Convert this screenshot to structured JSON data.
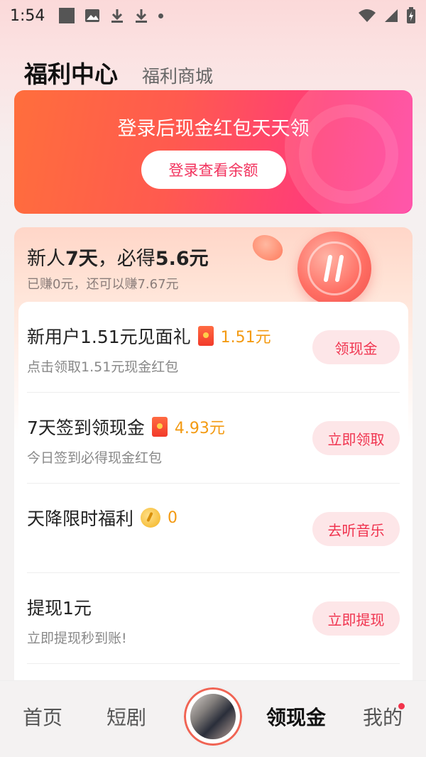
{
  "status": {
    "time": "1:54",
    "left_icons": [
      "square-app-icon",
      "image-icon",
      "download-icon",
      "download-icon",
      "dot-icon"
    ],
    "right_icons": [
      "wifi-icon",
      "signal-icon",
      "battery-icon"
    ]
  },
  "header": {
    "active_tab": "福利中心",
    "inactive_tab": "福利商城"
  },
  "banner": {
    "title": "登录后现金红包天天领",
    "button": "登录查看余额"
  },
  "newbie": {
    "title_prefix": "新人",
    "title_bold1": "7天",
    "title_mid": "，必得",
    "title_bold2": "5.6元",
    "subtitle": "已赚0元，还可以赚7.67元"
  },
  "tasks": [
    {
      "name": "新用户1.51元见面礼",
      "reward": "1.51元",
      "reward_icon": "red-packet-icon",
      "desc": "点击领取1.51元现金红包",
      "button": "领现金"
    },
    {
      "name": "7天签到领现金",
      "reward": "4.93元",
      "reward_icon": "red-packet-icon",
      "desc": "今日签到必得现金红包",
      "button": "立即领取"
    },
    {
      "name": "天降限时福利",
      "reward": "0",
      "reward_icon": "gold-coin-icon",
      "desc": "",
      "button": "去听音乐"
    },
    {
      "name": "提现1元",
      "reward": "",
      "reward_icon": "",
      "desc": "立即提现秒到账!",
      "button": "立即提现"
    }
  ],
  "bottom_nav": {
    "home": "首页",
    "drama": "短剧",
    "cash": "领现金",
    "mine": "我的"
  },
  "colors": {
    "accent": "#f0344f",
    "reward": "#f39a12",
    "banner_start": "#ff6e3c",
    "banner_end": "#ff3fa0"
  }
}
